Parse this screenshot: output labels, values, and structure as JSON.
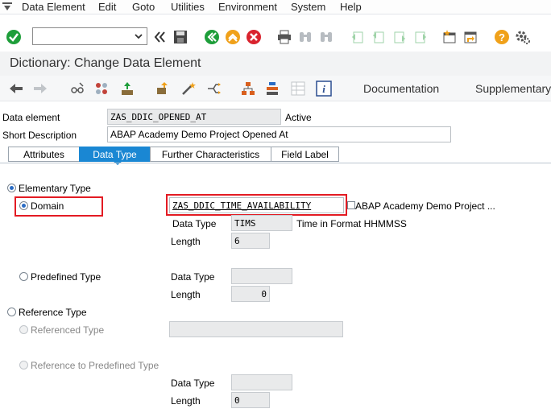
{
  "menubar": {
    "items": [
      "Data Element",
      "Edit",
      "Goto",
      "Utilities",
      "Environment",
      "System",
      "Help"
    ]
  },
  "toolbar": {
    "command_value": ""
  },
  "title": "Dictionary: Change Data Element",
  "app_toolbar": {
    "documentation": "Documentation",
    "supplementary": "Supplementary"
  },
  "header": {
    "data_element_label": "Data element",
    "data_element_value": "ZAS_DDIC_OPENED_AT",
    "status": "Active",
    "short_desc_label": "Short Description",
    "short_desc_value": "ABAP Academy Demo Project Opened At"
  },
  "tabs": [
    {
      "label": "Attributes"
    },
    {
      "label": "Data Type"
    },
    {
      "label": "Further Characteristics"
    },
    {
      "label": "Field Label"
    }
  ],
  "datatype": {
    "elementary_type": "Elementary Type",
    "domain_label": "Domain",
    "domain_value": "ZAS_DDIC_TIME_AVAILABILITY",
    "domain_desc": "ABAP Academy Demo Project ...",
    "dom_datatype_label": "Data Type",
    "dom_datatype_value": "TIMS",
    "dom_datatype_desc": "Time in Format HHMMSS",
    "dom_length_label": "Length",
    "dom_length_value": "6",
    "predefined_type": "Predefined Type",
    "pre_datatype_label": "Data Type",
    "pre_datatype_value": "",
    "pre_length_label": "Length",
    "pre_length_value": "0",
    "reference_type": "Reference Type",
    "referenced_type": "Referenced Type",
    "referenced_type_value": "",
    "ref_predefined_type": "Reference to Predefined Type",
    "ref_datatype_label": "Data Type",
    "ref_datatype_value": "",
    "ref_length_label": "Length",
    "ref_length_value": "0"
  },
  "colors": {
    "active_tab": "#1a87d3",
    "highlight_box": "#e31b23"
  }
}
